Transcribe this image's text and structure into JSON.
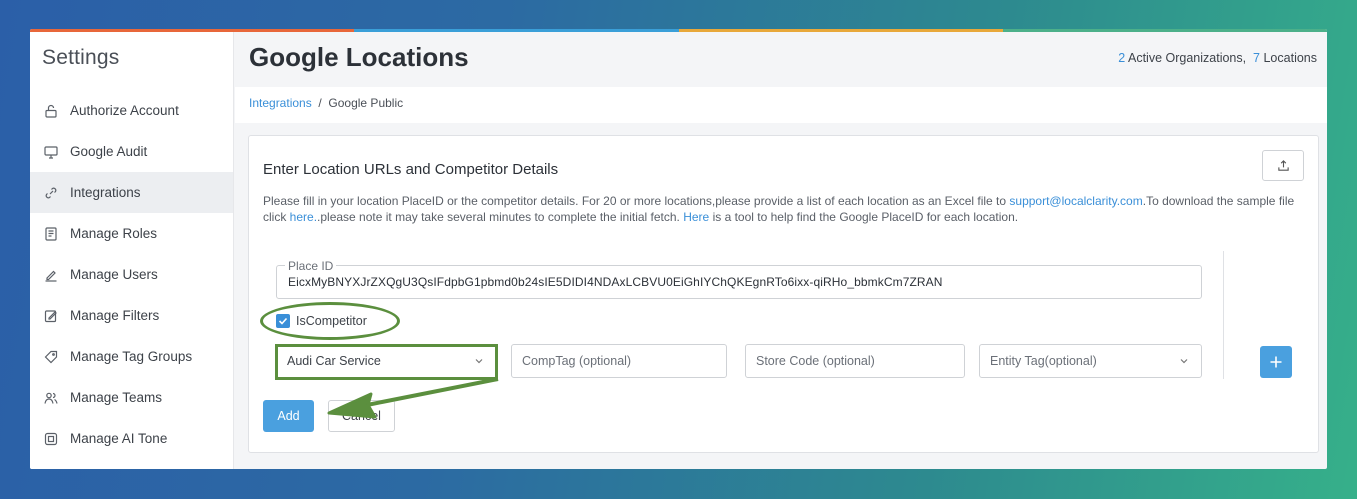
{
  "colors": {
    "accent": "#3a8fd8",
    "button": "#4aa0df",
    "highlight": "#5b8f3e",
    "stripe": [
      "#e8673a",
      "#3a9fd8",
      "#e8a83a",
      "#4cb08a"
    ]
  },
  "sidebar": {
    "title": "Settings",
    "items": [
      {
        "label": "Authorize Account",
        "icon": "lock-icon"
      },
      {
        "label": "Google Audit",
        "icon": "monitor-icon"
      },
      {
        "label": "Integrations",
        "icon": "link-icon",
        "active": true
      },
      {
        "label": "Manage Roles",
        "icon": "id-card-icon"
      },
      {
        "label": "Manage Users",
        "icon": "pencil-icon"
      },
      {
        "label": "Manage Filters",
        "icon": "edit-box-icon"
      },
      {
        "label": "Manage Tag Groups",
        "icon": "tag-icon"
      },
      {
        "label": "Manage Teams",
        "icon": "team-icon"
      },
      {
        "label": "Manage AI Tone",
        "icon": "chip-icon"
      }
    ]
  },
  "header": {
    "title": "Google Locations",
    "org_count": "2",
    "org_label": "Active Organizations,",
    "loc_count": "7",
    "loc_label": "Locations"
  },
  "breadcrumb": {
    "parent": "Integrations",
    "separator": "/",
    "current": "Google Public"
  },
  "card": {
    "title": "Enter Location URLs and Competitor Details",
    "desc_1": "Please fill in your location PlaceID or the competitor details. For 20 or more locations,please provide a list of each location as an Excel file to ",
    "email": "support@localclarity.com",
    "desc_2": ".To download the sample file click ",
    "here_1": "here.",
    "desc_3": ".please note it may take several minutes to complete the initial fetch. ",
    "here_2": "Here",
    "desc_4": " is a tool to help find the Google PlaceID for each location."
  },
  "form": {
    "place_label": "Place ID",
    "place_value": "EicxMyBNYXJrZXQgU3QsIFdpbG1pbmd0b24sIE5DIDI4NDAxLCBVU0EiGhIYChQKEgnRTo6ixx-qiRHo_bbmkCm7ZRAN",
    "competitor_label": "IsCompetitor",
    "competitor_checked": true,
    "competitor_select": "Audi Car Service",
    "comp_tag_placeholder": "CompTag (optional)",
    "store_code_placeholder": "Store Code (optional)",
    "entity_tag_placeholder": "Entity Tag(optional)",
    "add_label": "Add",
    "cancel_label": "Cancel"
  }
}
